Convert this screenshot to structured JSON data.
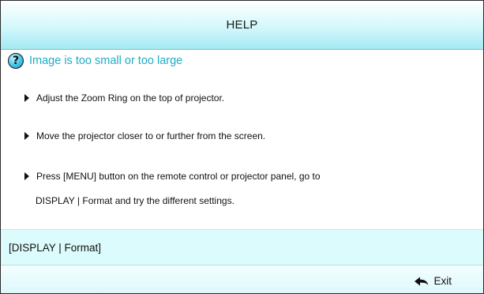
{
  "header": {
    "title": "HELP"
  },
  "topic": {
    "icon": "help-question-icon",
    "text": "Image is too small or too large",
    "color": "#20acc5"
  },
  "tips": [
    {
      "text": "Adjust the Zoom Ring on the top of projector."
    },
    {
      "text": "Move the projector closer to or further from the screen."
    },
    {
      "text": "Press [MENU] button on the remote control or projector panel, go to",
      "continuation": "DISPLAY | Format and try the different settings."
    }
  ],
  "path_bar": {
    "text": "[DISPLAY | Format]"
  },
  "footer": {
    "exit_icon": "return-arrow-icon",
    "exit_label": "Exit"
  }
}
